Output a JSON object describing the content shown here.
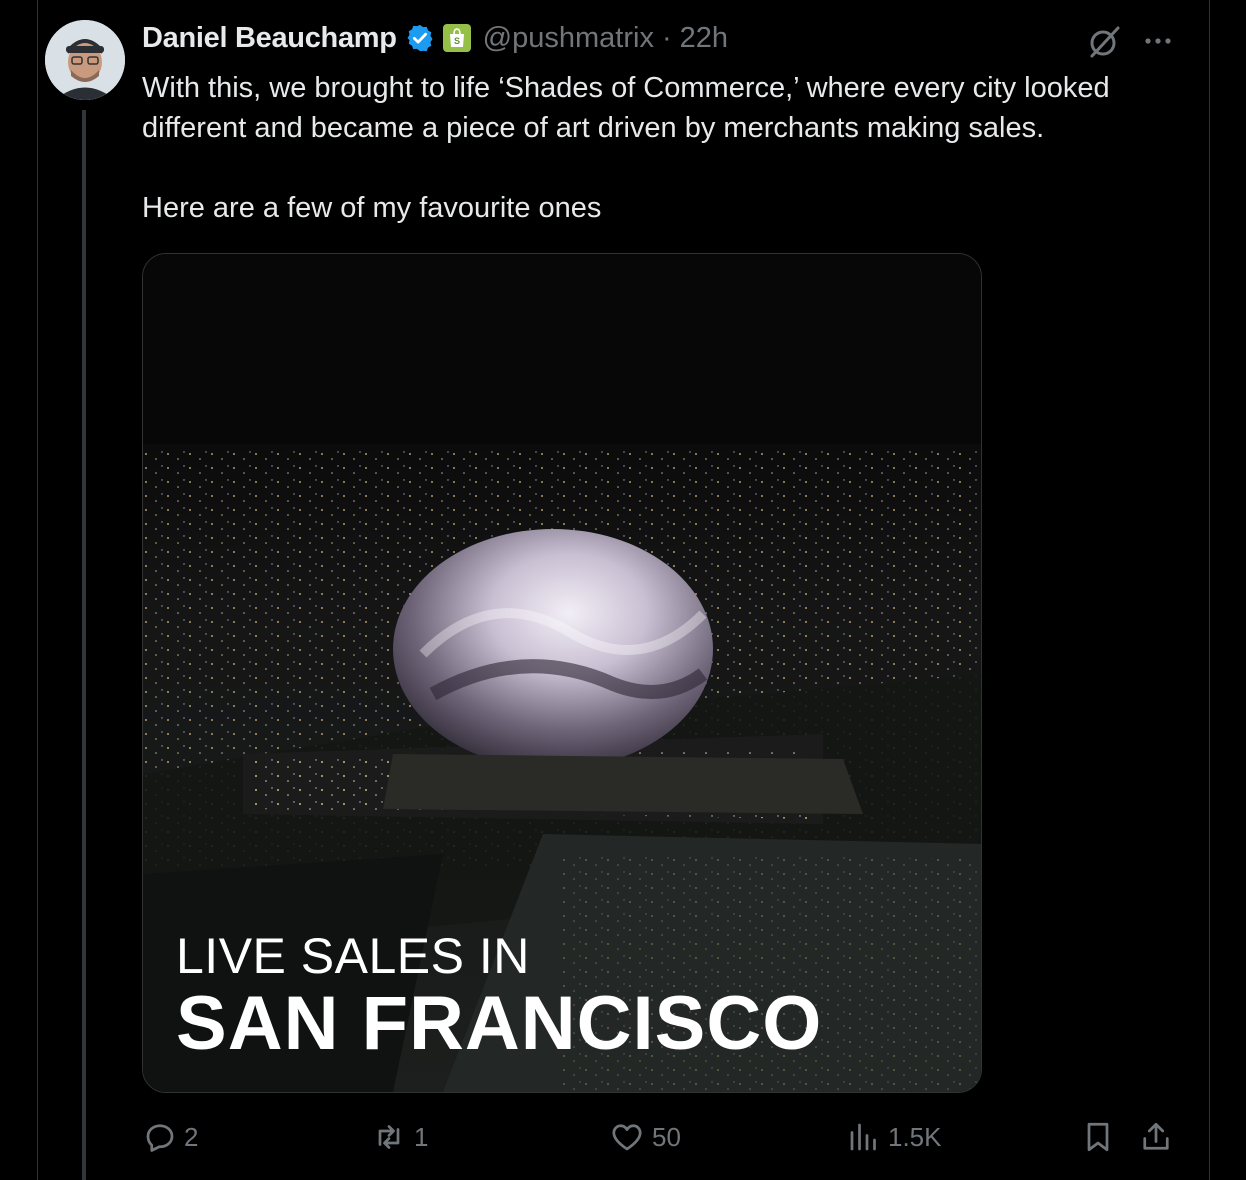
{
  "author": {
    "display_name": "Daniel Beauchamp",
    "handle": "@pushmatrix",
    "separator": "·",
    "time": "22h",
    "verified_color": "#1d9bf0",
    "affiliate_badge": "shopify-bag-icon"
  },
  "tweet": {
    "paragraphs": [
      "With this, we brought to life ‘Shades of Commerce,’ where every city looked different and became a piece of art driven by merchants making sales.",
      "Here are a few of my favourite ones"
    ]
  },
  "media": {
    "caption_line1": "LIVE SALES IN",
    "caption_line2": "SAN FRANCISCO"
  },
  "actions": {
    "replies": "2",
    "reposts": "1",
    "likes": "50",
    "views": "1.5K"
  },
  "icons": {
    "grok": "grok-icon",
    "more": "more-icon",
    "reply": "reply-icon",
    "repost": "repost-icon",
    "like": "heart-icon",
    "views": "views-chart-icon",
    "bookmark": "bookmark-icon",
    "share": "share-icon"
  },
  "colors": {
    "background": "#000000",
    "text": "#e7e9ea",
    "muted": "#71767b",
    "border": "#2f3336"
  }
}
